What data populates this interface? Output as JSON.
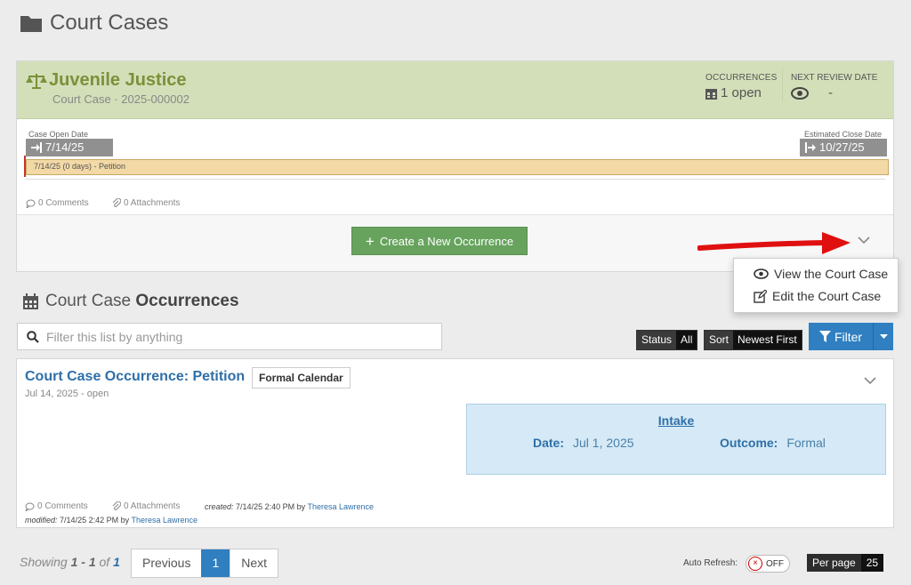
{
  "page": {
    "title": "Court Cases"
  },
  "case": {
    "name": "Juvenile Justice",
    "subtitle": "Court Case · 2025-000002",
    "occurrences_label": "OCCURRENCES",
    "occurrences_value": "1 open",
    "review_label": "NEXT REVIEW DATE",
    "review_value": "-",
    "open_date_label": "Case Open Date",
    "open_date": "7/14/25",
    "close_date_label": "Estimated Close Date",
    "close_date": "10/27/25",
    "timeline_text": "7/14/25 (0 days) - Petition",
    "comments": "0 Comments",
    "attachments": "0 Attachments",
    "create_button": "Create a New Occurrence"
  },
  "dropdown": {
    "view": "View the Court Case",
    "edit": "Edit the Court Case"
  },
  "occurrences": {
    "section_prefix": "Court Case ",
    "section_bold": "Occurrences",
    "search_placeholder": "Filter this list by anything",
    "status_label": "Status",
    "status_value": "All",
    "sort_label": "Sort",
    "sort_value": "Newest First",
    "filter_button": "Filter",
    "item": {
      "title": "Court Case Occurrence: Petition",
      "badge": "Formal Calendar",
      "date": "Jul 14, 2025 - open",
      "intake_title": "Intake",
      "date_label": "Date:",
      "date_value": "Jul 1, 2025",
      "outcome_label": "Outcome:",
      "outcome_value": "Formal",
      "comments": "0 Comments",
      "attachments": "0 Attachments",
      "created_label": "created:",
      "created_value": "7/14/25 2:40 PM by",
      "created_by": "Theresa Lawrence",
      "modified_label": "modified:",
      "modified_value": "7/14/25 2:42 PM by",
      "modified_by": "Theresa Lawrence"
    }
  },
  "pagination": {
    "showing": "Showing",
    "range": "1 - 1",
    "of": "of",
    "total": "1",
    "previous": "Previous",
    "current": "1",
    "next": "Next",
    "auto_refresh": "Auto Refresh:",
    "toggle": "OFF",
    "per_page_label": "Per page",
    "per_page_value": "25"
  },
  "colors": {
    "accent_green": "#67a35d",
    "accent_blue": "#2f7fc1",
    "arrow_red": "#e01010"
  }
}
